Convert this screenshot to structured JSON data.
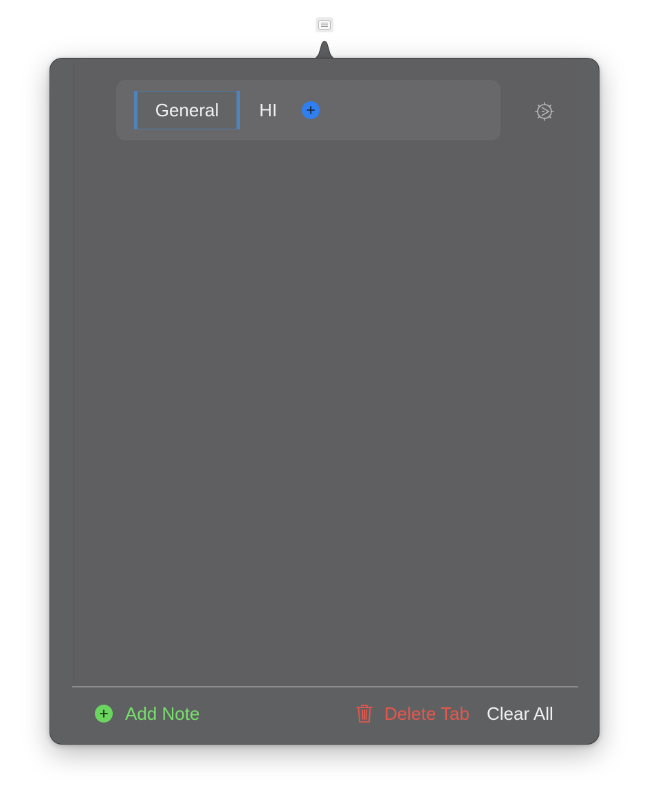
{
  "status_item": {
    "icon": "notes-list-icon"
  },
  "tabs": {
    "items": [
      {
        "label": "General",
        "active": true
      },
      {
        "label": "HI",
        "active": false
      }
    ],
    "add_icon": "plus-circle-icon"
  },
  "settings": {
    "icon": "gear-icon"
  },
  "footer": {
    "add_note_label": "Add Note",
    "delete_tab_label": "Delete Tab",
    "clear_all_label": "Clear All"
  },
  "colors": {
    "accent_blue": "#2f7ff0",
    "add_green": "#77e06c",
    "delete_red": "#e5574c",
    "panel_bg": "#5f6062",
    "active_tab_border": "#4f83ba"
  }
}
